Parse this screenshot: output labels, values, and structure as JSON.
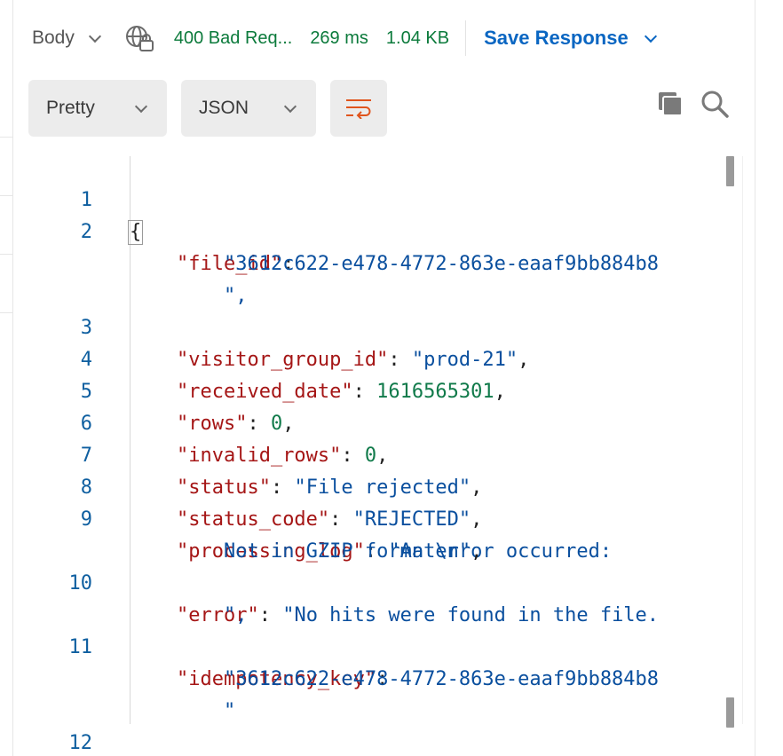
{
  "status_bar": {
    "body_label": "Body",
    "status": "400 Bad Req...",
    "time": "269 ms",
    "size": "1.04 KB",
    "save_label": "Save Response"
  },
  "toolbar": {
    "view_mode": "Pretty",
    "format": "JSON"
  },
  "colors": {
    "status_ok_text": "#0b7a3b",
    "accent": "#0a66c2",
    "json_key": "#a51616",
    "json_string": "#0a4f9e",
    "json_number": "#107a4a",
    "line_number": "#0f5fa0",
    "wrap_icon": "#e0541c"
  },
  "icons": [
    "chevron-down-icon",
    "globe-lock-icon",
    "wrap-lines-icon",
    "copy-icon",
    "search-icon"
  ],
  "code": {
    "line_numbers": [
      "1",
      "2",
      "3",
      "4",
      "5",
      "6",
      "7",
      "8",
      "9",
      "10",
      "11",
      "12"
    ],
    "open_brace": "{",
    "close_brace": "}",
    "file_id_key": "\"file_id\"",
    "file_id_value_1": "\"3612c622-e478-4772-863e-eaaf9bb884b8",
    "file_id_value_2": "\",",
    "visitor_group_id_key": "\"visitor_group_id\"",
    "visitor_group_id_value": "\"prod-21\"",
    "received_date_key": "\"received_date\"",
    "received_date_value": "1616565301",
    "rows_key": "\"rows\"",
    "rows_value": "0",
    "invalid_rows_key": "\"invalid_rows\"",
    "invalid_rows_value": "0",
    "status_key": "\"status\"",
    "status_value": "\"File rejected\"",
    "status_code_key": "\"status_code\"",
    "status_code_value": "\"REJECTED\"",
    "processing_log_key": "\"processing_log\"",
    "processing_log_value_1": "\"An error occurred:",
    "processing_log_value_2": "Not in GZIP format\\n\"",
    "error_key": "\"error\"",
    "error_value_1": "\"No hits were found in the file.",
    "error_value_2": "\",",
    "idempotency_key_key": "\"idempotency_key\"",
    "idempotency_key_value_1": "\"3612c622-e478-4772-863e-eaaf9bb884b8",
    "idempotency_key_value_2": "\""
  }
}
